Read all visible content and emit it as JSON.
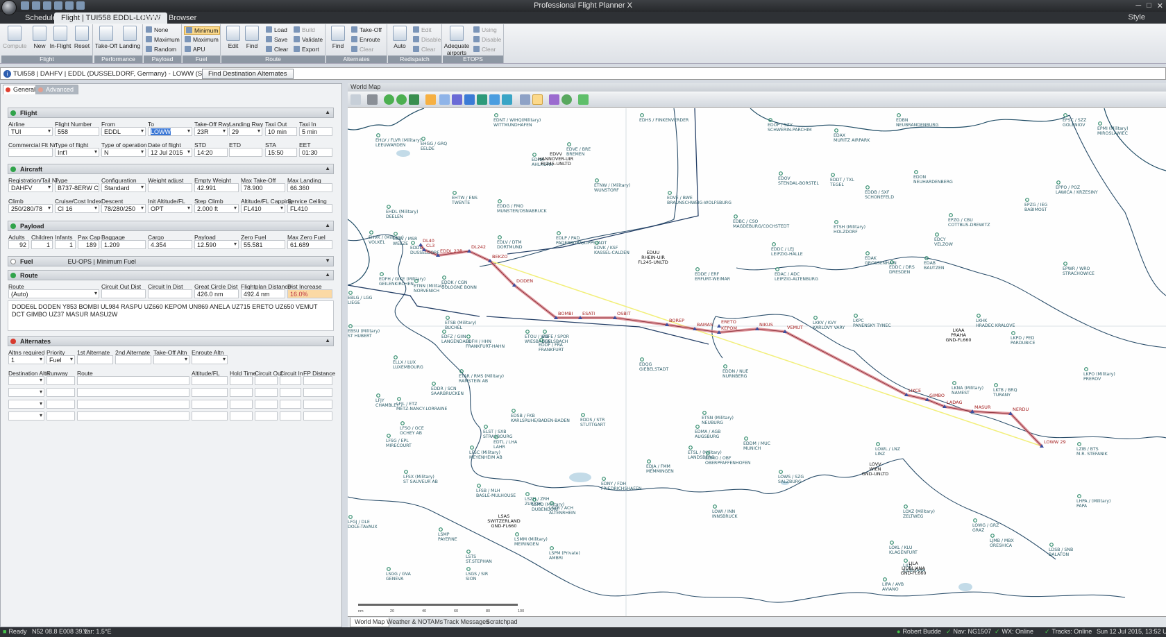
{
  "window": {
    "title": "Professional Flight Planner X",
    "close_label": "✕",
    "minimize_label": "─",
    "maximize_label": "□"
  },
  "ribbon_tabs": [
    "Schedule",
    "Flight | TUI558 EDDL-LOWW",
    "Traffic",
    "Browser"
  ],
  "style_label": "Style",
  "ribbon": {
    "flight": {
      "label": "Flight",
      "compute": "Compute",
      "new": "New",
      "inflight": "In-Flight",
      "reset": "Reset"
    },
    "performance": {
      "label": "Performance",
      "takeoff": "Take-Off",
      "landing": "Landing"
    },
    "payload": {
      "label": "Payload",
      "none": "None",
      "maximum": "Maximum",
      "random": "Random"
    },
    "fuel": {
      "label": "Fuel",
      "minimum": "Minimum",
      "maximum": "Maximum",
      "apu": "APU"
    },
    "route": {
      "label": "Route",
      "edit": "Edit",
      "find": "Find",
      "load": "Load",
      "save": "Save",
      "clear": "Clear",
      "build": "Build",
      "validate": "Validate",
      "export": "Export"
    },
    "alternates": {
      "label": "Alternates",
      "find": "Find",
      "takeoff": "Take-Off",
      "enroute": "Enroute",
      "clear": "Clear"
    },
    "redispatch": {
      "label": "Redispatch",
      "auto": "Auto",
      "edit": "Edit",
      "disable": "Disable",
      "clear": "Clear"
    },
    "etops": {
      "label": "ETOPS",
      "adequate": "Adequate airports",
      "using": "Using",
      "disable": "Disable",
      "clear": "Clear"
    }
  },
  "infobar": {
    "text": "TUI558 | DAHFV | EDDL (DUSSELDORF, Germany) - LOWW (SCHWECHAT, Austria)",
    "button": "Find Destination Alternates"
  },
  "panel_tabs": {
    "general": "General",
    "advanced": "Advanced"
  },
  "flight": {
    "title": "Flight",
    "labels": {
      "airline": "Airline",
      "flight_number": "Flight Number",
      "from": "From",
      "to": "To",
      "takeoff_rwy": "Take-Off Rwy",
      "landing_rwy": "Landing Rwy",
      "taxi_out": "Taxi Out",
      "taxi_in": "Taxi In",
      "commercial": "Commercial Flt Nr",
      "type_of_flight": "Type of flight",
      "type_of_operation": "Type of operation",
      "date": "Date of flight",
      "std": "STD",
      "etd": "ETD",
      "sta": "STA",
      "eet": "EET"
    },
    "values": {
      "airline": "TUI",
      "flight_number": "558",
      "from": "EDDL",
      "to": "LOWW",
      "takeoff_rwy": "23R",
      "landing_rwy": "29",
      "taxi_out": "10 min",
      "taxi_in": "5 min",
      "commercial": "",
      "type_of_flight": "Int'l",
      "type_of_operation": "N",
      "date": "12 Jul 2015",
      "std": "14:20",
      "etd": "",
      "sta": "15:50",
      "eet": "01:30"
    }
  },
  "aircraft": {
    "title": "Aircraft",
    "labels": {
      "reg": "Registration/Tail Nr",
      "type": "Type",
      "config": "Configuration",
      "weight_adjust": "Weight adjust",
      "empty_weight": "Empty Weight",
      "max_takeoff": "Max Take-Off",
      "max_landing": "Max Landing",
      "climb": "Climb",
      "cruise": "Cruise/Cost Index",
      "descent": "Descent",
      "init_alt": "Init Altitude/FL",
      "step_climb": "Step Climb",
      "alt_capping": "Altitude/FL Capping",
      "service_ceiling": "Service Ceiling"
    },
    "values": {
      "reg": "DAHFV",
      "type": "B737-8ERW CF",
      "config": "Standard",
      "weight_adjust": "",
      "empty_weight": "42.991",
      "max_takeoff": "78.900",
      "max_landing": "66.360",
      "climb": "250/280/78",
      "cruise": "CI 16",
      "descent": "78/280/250",
      "init_alt": "OPT",
      "step_climb": "2.000 ft",
      "alt_capping": "FL410",
      "service_ceiling": "FL410"
    }
  },
  "payload": {
    "title": "Payload",
    "labels": {
      "adults": "Adults",
      "children": "Children",
      "infants": "Infants",
      "pax_cap": "Pax Cap",
      "baggage": "Baggage",
      "cargo": "Cargo",
      "payload": "Payload",
      "zero_fuel": "Zero Fuel",
      "max_zero_fuel": "Max Zero Fuel"
    },
    "values": {
      "adults": "92",
      "children": "1",
      "infants": "1",
      "pax_cap": "189",
      "baggage": "1.209",
      "cargo": "4.354",
      "payload": "12.590",
      "zero_fuel": "55.581",
      "max_zero_fuel": "61.689"
    }
  },
  "fuel": {
    "title": "Fuel",
    "policy": "EU-OPS | Minimum Fuel"
  },
  "route": {
    "title": "Route",
    "labels": {
      "route": "Route",
      "circuit_out": "Circuit Out Dist",
      "circuit_in": "Circuit In Dist",
      "gc_dist": "Great Circle Dist",
      "fp_dist": "Flightplan Distance",
      "dist_increase": "Dist Increase"
    },
    "values": {
      "route": "(Auto)",
      "circuit_out": "",
      "circuit_in": "",
      "gc_dist": "426.0 nm",
      "fp_dist": "492.4 nm",
      "dist_increase": "16.0%"
    },
    "string": "DODE6L DODEN Y853 BOMBI UL984 RASPU UZ660 KEPOM UN869 ANELA UZ715 ERETO UZ650 VEMUT DCT GIMBO UZ37 MASUR MASU2W"
  },
  "alternates": {
    "title": "Alternates",
    "labels": {
      "altns_required": "Altns required",
      "priority": "Priority",
      "first": "1st Alternate",
      "second": "2nd Alternate",
      "takeoff_altn": "Take-Off Altn",
      "enroute_altn": "Enroute Altn"
    },
    "values": {
      "altns_required": "1",
      "priority": "Fuel"
    },
    "table_headers": [
      "Destination Altn",
      "Runway",
      "Route",
      "Altitude/FL",
      "Hold Time",
      "Circuit Out",
      "Circuit In",
      "FP Distance"
    ]
  },
  "map": {
    "header": "World Map",
    "airports": [
      [
        "EHLV / FLVR (Military)",
        "LEEUWARDEN",
        40,
        35
      ],
      [
        "EHGG / GRQ",
        "EELDE",
        105,
        40
      ],
      [
        "EDHA",
        "AHLHORN",
        265,
        63
      ],
      [
        "EDVE / BRE",
        "BREMEN",
        315,
        48
      ],
      [
        "EDNT / WIHQ(Military)",
        "WITTMUNDHAFEN",
        210,
        6
      ],
      [
        "EDHS / FINKENVERDER",
        "",
        420,
        6
      ],
      [
        "EDOP / SZV",
        "SCHWERIN-PARCHIM",
        605,
        13
      ],
      [
        "EDAX",
        "MURITZ AIRPARK",
        700,
        28
      ],
      [
        "EDBN",
        "NEUBRANDENBURG",
        790,
        6
      ],
      [
        "EPSC / SZZ",
        "GOLENIOV",
        1030,
        6
      ],
      [
        "EPMI (Military)",
        "MIROSLAWIEC",
        1080,
        18
      ],
      [
        "EHTW / ENS",
        "TWENTE",
        150,
        118
      ],
      [
        "EDDG / FMO",
        "MUNSTER/OSNABRUCK",
        215,
        130
      ],
      [
        "ETNW / (Military)",
        "WUNSTORF",
        355,
        100
      ],
      [
        "EDVE / BWE",
        "BRAUNSCHWEIG-WOLFSBURG",
        460,
        118
      ],
      [
        "EDOV",
        "STENDAL-BORSTEL",
        620,
        90
      ],
      [
        "EDDT / TXL",
        "TEGEL",
        695,
        92
      ],
      [
        "EDON",
        "NEUHARDENBERG",
        815,
        88
      ],
      [
        "EDDB / SXF",
        "SCHONEFELD",
        745,
        110
      ],
      [
        "EPZG / IEG",
        "BABIMOST",
        975,
        128
      ],
      [
        "EPPO / POZ",
        "LAWICA / KRZESINY",
        1020,
        103
      ],
      [
        "EHDL (Military)",
        "DEELEN",
        55,
        138
      ],
      [
        "EDLV / DTM",
        "DORTMUND",
        215,
        182
      ],
      [
        "EDLP / PAD",
        "PADERBORN/LIPPSTADT",
        300,
        176
      ],
      [
        "EDVK / KSF",
        "KASSEL-CALDEN",
        355,
        190
      ],
      [
        "EDBC / CSO",
        "MAGDEBURG/COCHSTEDT",
        555,
        152
      ],
      [
        "ETSH (Military)",
        "HOLZDORF",
        700,
        160
      ],
      [
        "EPZG / CBU",
        "COTTBUS-DREWITZ",
        865,
        150
      ],
      [
        "EDCY",
        "VELZOW",
        845,
        178
      ],
      [
        "EHVK / (Military)",
        "VOLKEL",
        30,
        175
      ],
      [
        "EDLV / MSR",
        "WEEZE",
        65,
        177
      ],
      [
        "EDDL",
        "DUSSELDORF",
        90,
        190
      ],
      [
        "EDDC / LEJ",
        "LEIPZIG-HALLE",
        610,
        192
      ],
      [
        "EDAK",
        "GROSSENHAIN",
        745,
        205
      ],
      [
        "EDDC / DRS",
        "DRESDEN",
        780,
        218
      ],
      [
        "EDAB",
        "BAUTZEN",
        830,
        212
      ],
      [
        "EPWR / WRO",
        "STRACHOWICE",
        1030,
        220
      ],
      [
        "EDDK / CGN",
        "COLOGNE BONN",
        135,
        240
      ],
      [
        "EDDE / ERF",
        "ERFURT-WEIMAR",
        500,
        228
      ],
      [
        "EDAC / ADC",
        "LEIPZIG-ALTENBURG",
        615,
        228
      ],
      [
        "ETNN (Military)",
        "NORVENICH",
        95,
        245
      ],
      [
        "EDFH / GIKE (Military)",
        "GEILENKIRCHEN",
        45,
        235
      ],
      [
        "EBLG / LGG",
        "LIEGE",
        0,
        262
      ],
      [
        "LKKV / KVY",
        "KARLOVY VARY",
        670,
        298
      ],
      [
        "LKPC",
        "PANENSKY TYNEC",
        728,
        295
      ],
      [
        "LKHK",
        "HRADEC KRALOVE",
        905,
        295
      ],
      [
        "LKPD / PED",
        "PARDUBICE",
        955,
        320
      ],
      [
        "ETSB (Military)",
        "BUCHEL",
        140,
        298
      ],
      [
        "EDFZ / GIIN",
        "LANGENDAHL",
        135,
        318
      ],
      [
        "EDFH / HHN",
        "FRANKFURT-HAHN",
        170,
        325
      ],
      [
        "ETOU / WIE",
        "WIESBADEN",
        255,
        318
      ],
      [
        "EDFE / SPOR",
        "EGELSBACH",
        280,
        318
      ],
      [
        "EDDF / FRA",
        "FRANKFURT",
        275,
        330
      ],
      [
        "EDQG",
        "GIEBELSTADT",
        420,
        358
      ],
      [
        "EDDN / NUE",
        "NURNBERG",
        540,
        368
      ],
      [
        "ELLX / LUX",
        "LUXEMBOURG",
        65,
        355
      ],
      [
        "EBSU (Military)",
        "ST HUBERT",
        0,
        310
      ],
      [
        "EDDR / SCN",
        "SAARBRUCKEN",
        120,
        393
      ],
      [
        "ETAR / RMS (Military)",
        "RAMSTEIN AB",
        160,
        375
      ],
      [
        "LFJY",
        "CHAMBLEY",
        40,
        410
      ],
      [
        "LFJL / ETZ",
        "METZ-NANCY-LORRAINE",
        70,
        415
      ],
      [
        "EDSB / FKB",
        "KARLSRUHE/BADEN-BADEN",
        235,
        432
      ],
      [
        "EDDS / STR",
        "STUTTGART",
        335,
        438
      ],
      [
        "ETSN (Military)",
        "NEUBURG",
        510,
        435
      ],
      [
        "EDMA / AGB",
        "AUGSBURG",
        500,
        455
      ],
      [
        "EDDM / MUC",
        "MUNICH",
        570,
        472
      ],
      [
        "LFSO / OCE",
        "OCHEY AB",
        75,
        450
      ],
      [
        "LFSG / EPL",
        "MIRECOURT",
        55,
        468
      ],
      [
        "ELST / SXB",
        "STRASBOURG",
        195,
        455
      ],
      [
        "EDTL / LHA",
        "LAHR",
        210,
        470
      ],
      [
        "LFSX (Military)",
        "ST SAUVEUR AB",
        80,
        520
      ],
      [
        "LFSC (Military)",
        "MEYENHEIM AB",
        175,
        485
      ],
      [
        "LFSB / MLH",
        "BASLE-MULHOUSE",
        185,
        540
      ],
      [
        "EDJA / FMM",
        "MEMMINGEN",
        430,
        505
      ],
      [
        "ETSL / (Military)",
        "LANDSBERG",
        490,
        485
      ],
      [
        "EDMO / OBF",
        "OBERPFAFFENHOFEN",
        515,
        493
      ],
      [
        "EDNY / FDH",
        "FRIEDRICHSHAFEN",
        365,
        530
      ],
      [
        "LOWS / SZG",
        "SALZBURG",
        620,
        520
      ],
      [
        "LOWL / LNZ",
        "LINZ",
        760,
        480
      ],
      [
        "LOWI / INN",
        "INNSBRUCK",
        525,
        570
      ],
      [
        "LSZH / ZRH",
        "ZURICH",
        255,
        552
      ],
      [
        "LSMD (Military)",
        "DUBENDORF",
        265,
        560
      ],
      [
        "LSZR / ACH",
        "ALTENRHEIN",
        290,
        565
      ],
      [
        "LSMP",
        "PAYERNE",
        130,
        603
      ],
      [
        "LSMM (Military)",
        "MEIRINGEN",
        240,
        610
      ],
      [
        "LSPM (Private)",
        "AMBRI",
        290,
        630
      ],
      [
        "LSTS",
        "ST.STEPHAN",
        170,
        635
      ],
      [
        "LSGG / GVA",
        "GENEVA",
        55,
        660
      ],
      [
        "LSGS / SIR",
        "SION",
        170,
        660
      ],
      [
        "LOXZ (Military)",
        "ZELTWEG",
        800,
        570
      ],
      [
        "LOWG / GRZ",
        "GRAZ",
        900,
        590
      ],
      [
        "LOKL / KLU",
        "KLAGENFURT",
        780,
        622
      ],
      [
        "LJMB / MBX",
        "ORESHICA",
        925,
        612
      ],
      [
        "LDSB / SNB",
        "BALATON",
        1010,
        625
      ],
      [
        "LZIB / BTS",
        "M.R. STEFANIK",
        1050,
        480
      ],
      [
        "LKNA (Military)",
        "NAMEST",
        870,
        392
      ],
      [
        "LKTB / BRQ",
        "TURANY",
        930,
        395
      ],
      [
        "LKPO (Military)",
        "PREROV",
        1060,
        372
      ],
      [
        "LHPA / (Military)",
        "PAPA",
        1050,
        555
      ],
      [
        "LFGJ / DLE",
        "DOLE-TAVAUX",
        0,
        585
      ],
      [
        "LIPA / AVB",
        "AVIANO",
        770,
        675
      ],
      [
        "LJLJ",
        "LJUBLJANA",
        800,
        648
      ]
    ],
    "fir_labels": [
      [
        "EDVV",
        "HANNOVER-UIR",
        "FL245-UNLTD",
        300,
        68
      ],
      [
        "EDUU",
        "RHEIN-UIR",
        "FL245-UNLTD",
        440,
        210
      ],
      [
        "LKAA",
        "PRAHA",
        "GND-FL660",
        880,
        322
      ],
      [
        "LOVV",
        "WIEN",
        "GND-UNLTD",
        760,
        515
      ],
      [
        "LSAS",
        "SWITZERLAND",
        "GND-FL660",
        225,
        590
      ],
      [
        "LJLA",
        "LJUBLJANA",
        "GND-FL660",
        815,
        658
      ]
    ],
    "waypoints": [
      [
        "EDDL 23R",
        130,
        212
      ],
      [
        "DL242",
        175,
        206
      ],
      [
        "DODEN",
        240,
        255
      ],
      [
        "BOMBI",
        300,
        302
      ],
      [
        "ESATI",
        335,
        302
      ],
      [
        "OSBIT",
        385,
        302
      ],
      [
        "BOREP",
        460,
        312
      ],
      [
        "BAMAS",
        500,
        318
      ],
      [
        "ERETO",
        535,
        314
      ],
      [
        "KEPOM",
        535,
        323
      ],
      [
        "NIKUS",
        590,
        318
      ],
      [
        "VEMUT",
        630,
        322
      ],
      [
        "BEKZO",
        205,
        220
      ],
      [
        "LIKCE",
        805,
        413
      ],
      [
        "GIMBO",
        835,
        420
      ],
      [
        "LADAG",
        860,
        430
      ],
      [
        "MASUR",
        900,
        437
      ],
      [
        "NERDU",
        955,
        440
      ],
      [
        "LOWW 29",
        1000,
        487
      ],
      [
        "DL40",
        105,
        197
      ],
      [
        "CL3",
        110,
        204
      ]
    ],
    "scale_labels": [
      "nm",
      "20",
      "40",
      "60",
      "80",
      "100"
    ]
  },
  "bottom_tabs": [
    "World Map",
    "Weather & NOTAMs",
    "Track Messages",
    "Scratchpad"
  ],
  "status": {
    "ready": "Ready",
    "position": "N52 08.8 E008 39.1",
    "variation": "Var: 1.5°E",
    "user": "Robert Budde",
    "nav": "Nav: NG1507",
    "wx": "WX: Online",
    "tracks": "Tracks: Online",
    "time": "Sun 12 Jul 2015, 13:52 UTC"
  },
  "colors": {
    "accent": "#e04030",
    "route_line": "#d6747c",
    "gc_line": "#f2ef7a",
    "border": "#224466",
    "airport": "#2e8a6a"
  }
}
